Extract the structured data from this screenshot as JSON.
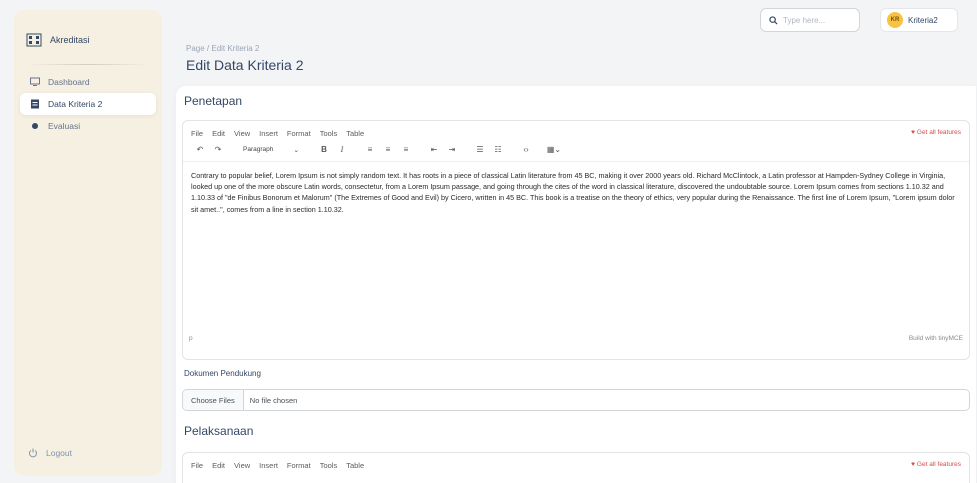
{
  "sidebar": {
    "brand": "Akreditasi",
    "items": [
      {
        "label": "Dashboard",
        "icon": "monitor-icon",
        "active": false
      },
      {
        "label": "Data Kriteria 2",
        "icon": "document-icon",
        "active": true
      },
      {
        "label": "Evaluasi",
        "icon": "dot-icon",
        "active": false
      }
    ],
    "logout": "Logout"
  },
  "header": {
    "breadcrumb": "Page / Edit Kriteria 2",
    "title": "Edit Data Kriteria 2",
    "search_placeholder": "Type here...",
    "user": {
      "initials": "KR",
      "name": "Kriteria2",
      "avatar_color": "#f6c343"
    }
  },
  "sections": {
    "penetapan": {
      "title": "Penetapan",
      "menu": [
        "File",
        "Edit",
        "View",
        "Insert",
        "Format",
        "Tools",
        "Table"
      ],
      "get_all_features": "Get all features",
      "paragraph_select": "Paragraph",
      "content": "Contrary to popular belief, Lorem Ipsum is not simply random text. It has roots in a piece of classical Latin literature from 45 BC, making it over 2000 years old. Richard McClintock, a Latin professor at Hampden-Sydney College in Virginia, looked up one of the more obscure Latin words, consectetur, from a Lorem Ipsum passage, and going through the cites of the word in classical literature, discovered the undoubtable source. Lorem Ipsum comes from sections 1.10.32 and 1.10.33 of \"de Finibus Bonorum et Malorum\" (The Extremes of Good and Evil) by Cicero, written in 45 BC. This book is a treatise on the theory of ethics, very popular during the Renaissance. The first line of Lorem Ipsum, \"Lorem ipsum dolor sit amet..\", comes from a line in section 1.10.32.",
      "status_left": "p",
      "status_right": "Build with tinyMCE"
    },
    "dokumen": {
      "label": "Dokumen Pendukung",
      "choose_files": "Choose Files",
      "no_file": "No file chosen"
    },
    "pelaksanaan": {
      "title": "Pelaksanaan",
      "menu": [
        "File",
        "Edit",
        "View",
        "Insert",
        "Format",
        "Tools",
        "Table"
      ],
      "get_all_features": "Get all features"
    }
  },
  "colors": {
    "accent": "#d84b4b",
    "sidebar_bg": "#f5f0e1"
  }
}
